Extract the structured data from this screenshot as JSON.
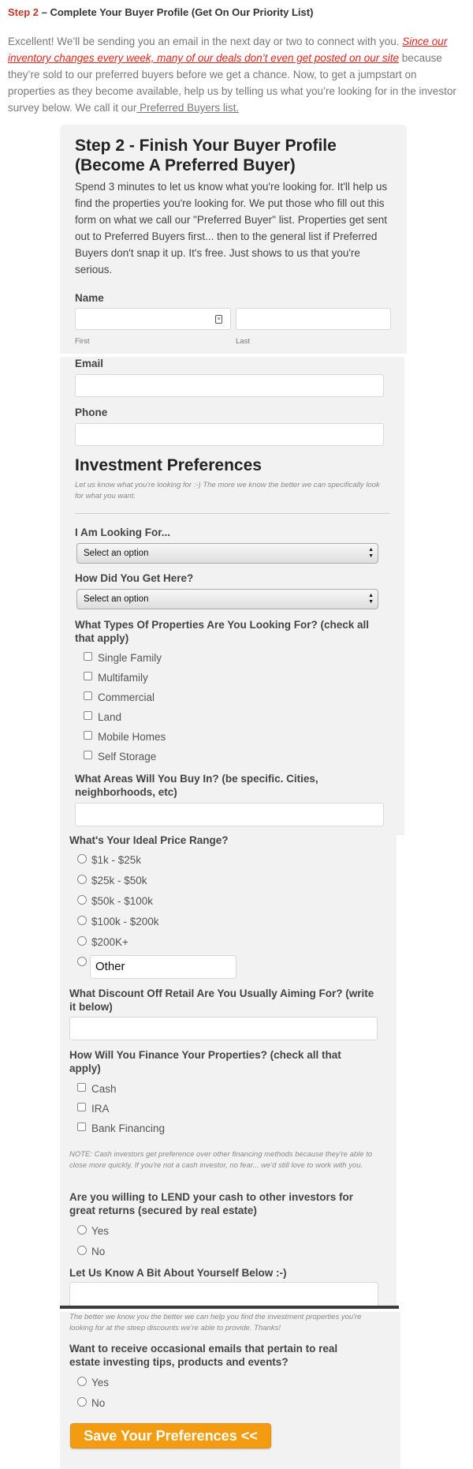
{
  "header": {
    "step_label": "Step 2",
    "step_title": " – Complete Your Buyer Profile (Get On Our Priority List)"
  },
  "intro": {
    "part1": "Excellent!  We’ll be sending you an email in the next day or two to connect with you.  ",
    "red_link": "Since our inventory changes every week, many of our deals don’t even get posted on our site",
    "part2": " because they’re sold to our preferred buyers before we get a chance. Now, to get a jumpstart on properties as they become available, help us by telling us what you’re looking for in the investor survey below.  We call it our",
    "plain_link": " Preferred Buyers list. "
  },
  "form": {
    "title": "Step 2 - Finish Your Buyer Profile (Become A Preferred Buyer)",
    "description": "Spend 3 minutes to let us know what you're looking for. It'll help us find the properties you're looking for. We put those who fill out this form on what we call our \"Preferred Buyer\" list. Properties get sent out to Preferred Buyers first... then to the general list if Preferred Buyers don't snap it up. It's free. Just shows to us that you're serious.",
    "name_label": "Name",
    "first_sub": "First",
    "last_sub": "Last",
    "email_label": "Email",
    "phone_label": "Phone",
    "invest_title": "Investment Preferences",
    "invest_note": "Let us know what you're looking for :-) The more we know the better we can specifically look for what you want.",
    "looking_label": "I Am Looking For...",
    "looking_value": "Select an option",
    "how_label": "How Did You Get Here?",
    "how_value": "Select an option",
    "types_label": "What Types Of Properties Are You Looking For? (check all that apply)",
    "types": [
      "Single Family",
      "Multifamily",
      "Commercial",
      "Land",
      "Mobile Homes",
      "Self Storage"
    ],
    "areas_label": "What Areas Will You Buy In? (be specific. Cities, neighborhoods, etc)",
    "price_label": "What's Your Ideal Price Range?",
    "prices": [
      "$1k - $25k",
      "$25k - $50k",
      "$50k - $100k",
      "$100k - $200k",
      "$200K+"
    ],
    "other_value": "Other",
    "discount_label": "What Discount Off Retail Are You Usually Aiming For? (write it below)",
    "finance_label": "How Will You Finance Your Properties? (check all that apply)",
    "finance": [
      "Cash",
      "IRA",
      "Bank Financing"
    ],
    "finance_note": "NOTE: Cash investors get preference over other financing methods because they're able to close more quickly. If you're not a cash investor, no fear... we'd still love to work with you.",
    "lend_label": "Are you willing to LEND your cash to other investors for great returns (secured by real estate)",
    "lend": [
      "Yes",
      "No"
    ],
    "about_label": "Let Us Know A Bit About Yourself Below :-)",
    "about_note": "The better we know you the better we can help you find the investment properties you're looking for at the steep discounts we're able to provide. Thanks!",
    "emails_label": "Want to receive occasional emails that pertain to real estate investing tips, products and events?",
    "emails": [
      "Yes",
      "No"
    ],
    "submit_label": "Save Your Preferences <<"
  },
  "colors": {
    "accent_red": "#c0392b",
    "link_red": "#e2231a",
    "panel_bg": "#f2f2f2",
    "button_orange": "#f39c12"
  }
}
